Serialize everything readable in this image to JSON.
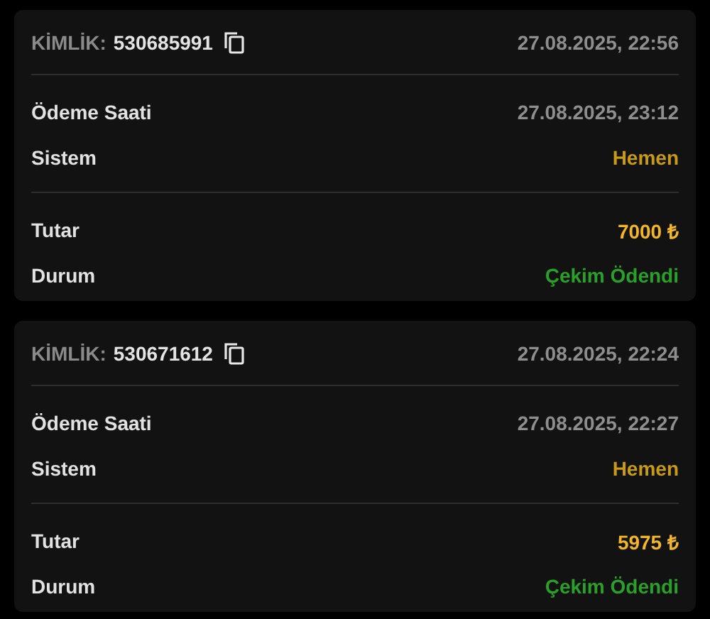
{
  "cards": [
    {
      "id_label": "KİMLİK:",
      "id": "530685991",
      "created": "27.08.2025, 22:56",
      "sections": [
        [
          {
            "label": "Ödeme Saati",
            "value": "27.08.2025, 23:12",
            "kind": "date"
          },
          {
            "label": "Sistem",
            "value": "Hemen",
            "kind": "system"
          }
        ],
        [
          {
            "label": "Tutar",
            "value": "7000 ₺",
            "kind": "amount"
          },
          {
            "label": "Durum",
            "value": "Çekim Ödendi",
            "kind": "status"
          }
        ]
      ]
    },
    {
      "id_label": "KİMLİK:",
      "id": "530671612",
      "created": "27.08.2025, 22:24",
      "sections": [
        [
          {
            "label": "Ödeme Saati",
            "value": "27.08.2025, 22:27",
            "kind": "date"
          },
          {
            "label": "Sistem",
            "value": "Hemen",
            "kind": "system"
          }
        ],
        [
          {
            "label": "Tutar",
            "value": "5975 ₺",
            "kind": "amount"
          },
          {
            "label": "Durum",
            "value": "Çekim Ödendi",
            "kind": "status"
          }
        ]
      ]
    }
  ]
}
